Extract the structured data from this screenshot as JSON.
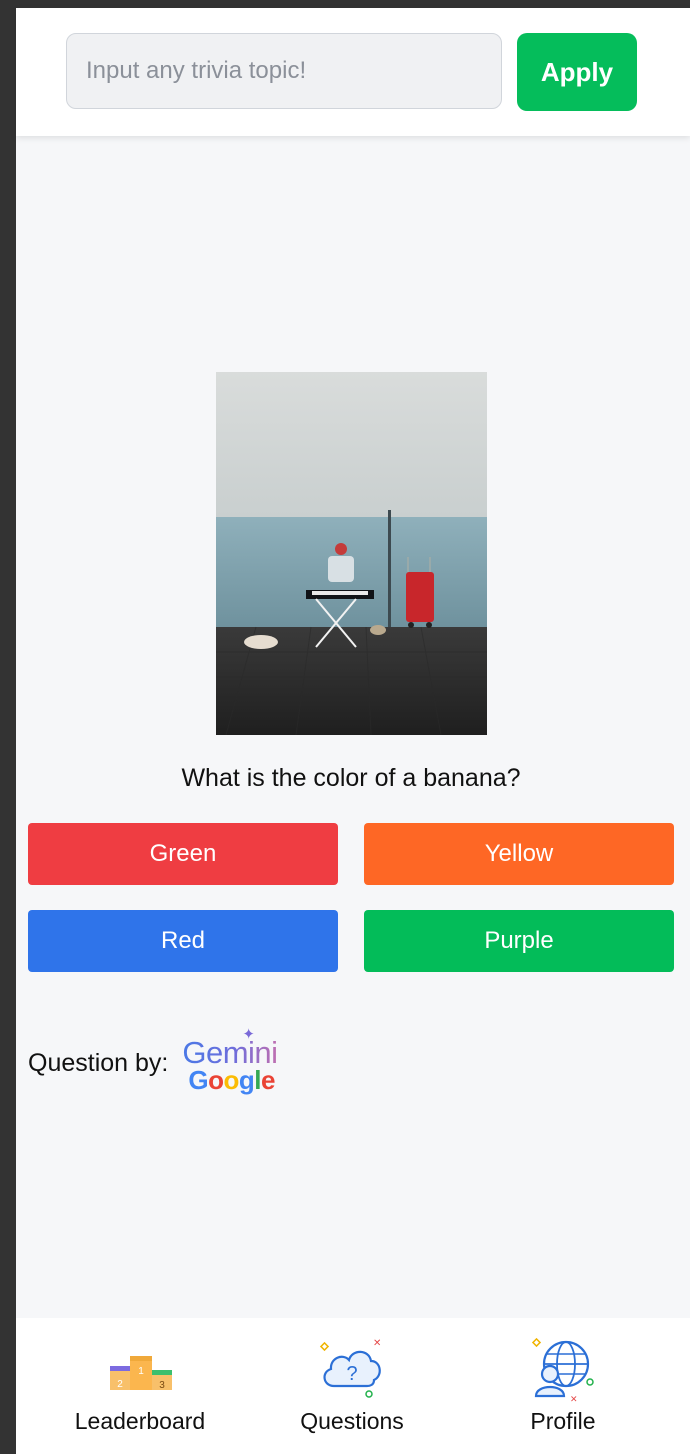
{
  "search": {
    "placeholder": "Input any trivia topic!",
    "value": "",
    "apply_label": "Apply"
  },
  "quiz": {
    "image_alt": "Street musician playing a keyboard beside a red shopping trolley",
    "question": "What is the color of a banana?",
    "answers": [
      {
        "label": "Green",
        "color": "#ef3d42"
      },
      {
        "label": "Yellow",
        "color": "#fe6725"
      },
      {
        "label": "Red",
        "color": "#2f74ea"
      },
      {
        "label": "Purple",
        "color": "#03bc59"
      }
    ]
  },
  "credit": {
    "label": "Question by:",
    "logo_top": "Gemini",
    "logo_bottom": "Google"
  },
  "nav": {
    "items": [
      {
        "label": "Leaderboard",
        "icon": "podium-icon"
      },
      {
        "label": "Questions",
        "icon": "question-cloud-icon"
      },
      {
        "label": "Profile",
        "icon": "globe-person-icon"
      }
    ]
  },
  "colors": {
    "apply": "#05bd5b",
    "background": "#f6f7f9"
  }
}
